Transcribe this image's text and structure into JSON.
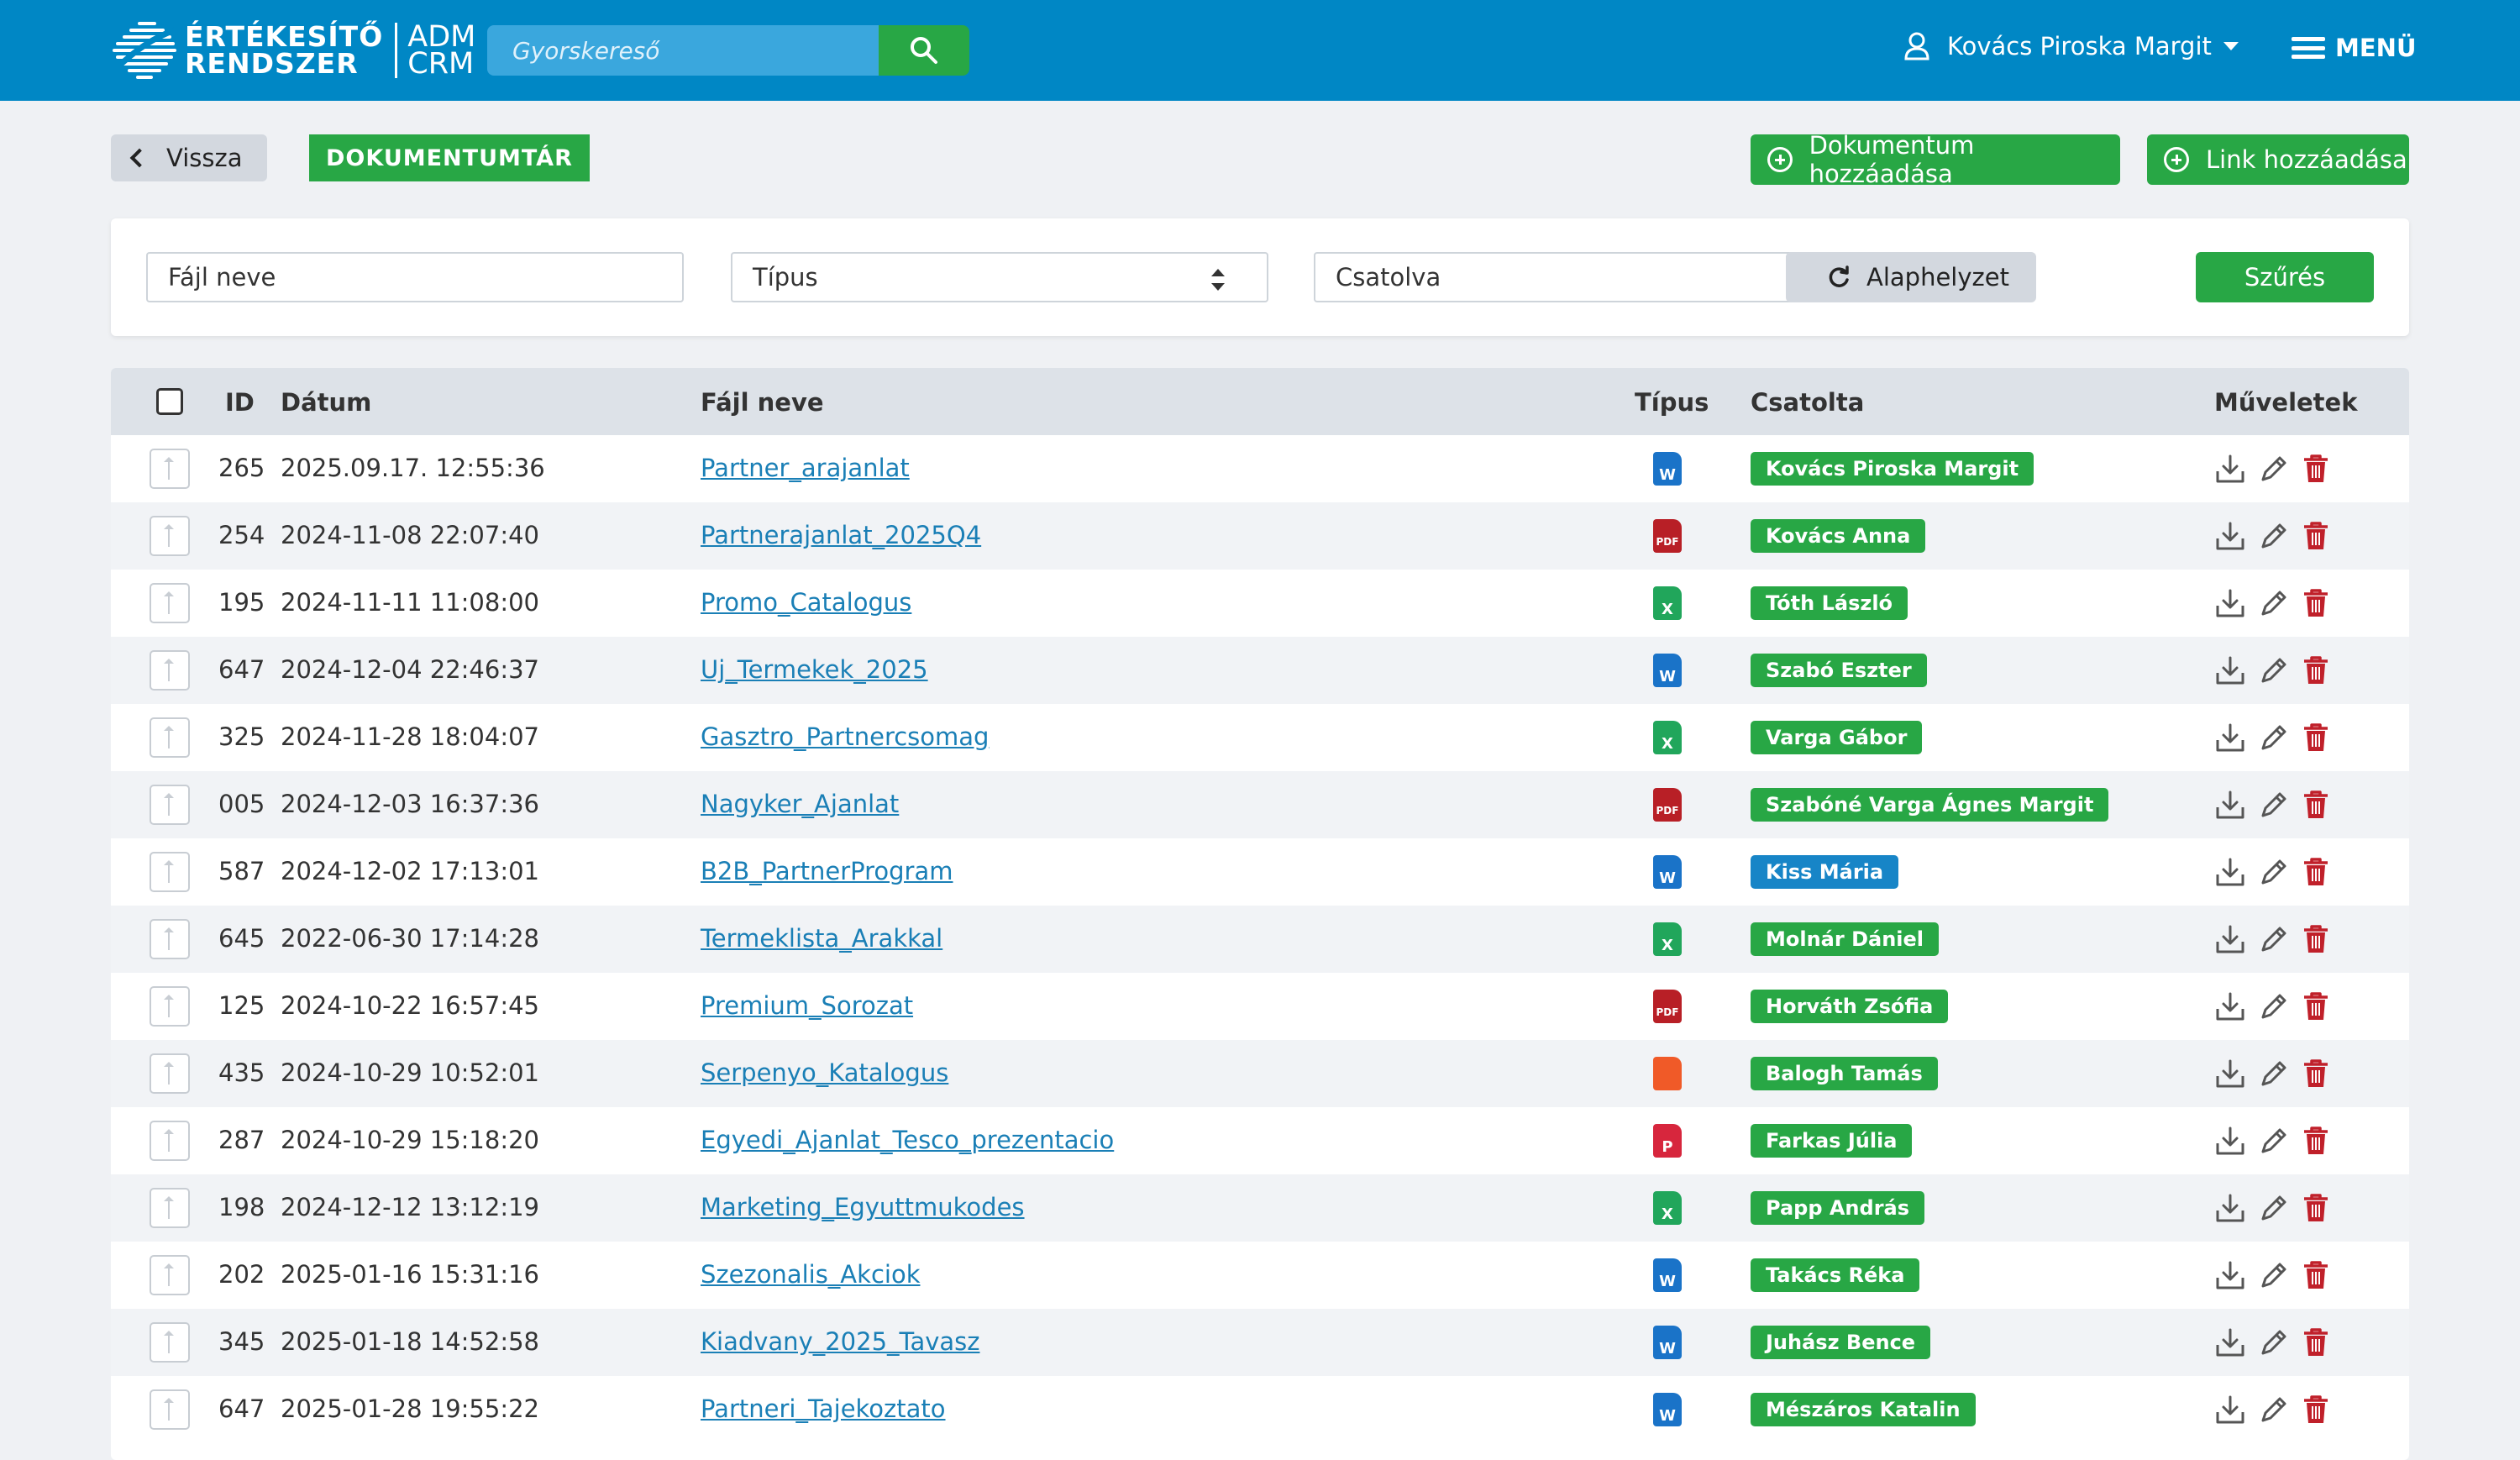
{
  "header": {
    "logo_line1": "ÉRTÉKESÍTŐ",
    "logo_line2": "RENDSZER",
    "logo_adm": "ADM",
    "logo_crm": "CRM",
    "search_placeholder": "Gyorskereső",
    "user_name": "Kovács Piroska Margit",
    "menu_label": "MENÜ"
  },
  "toolbar": {
    "back_label": "Vissza",
    "section_title": "DOKUMENTUMTÁR",
    "add_document_label": "Dokumentum hozzáadása",
    "add_link_label": "Link hozzáadása"
  },
  "filters": {
    "filename_placeholder": "Fájl neve",
    "type_select": "Típus",
    "attached_select": "Csatolva",
    "reset_label": "Alaphelyzet",
    "filter_label": "Szűrés"
  },
  "table": {
    "columns": {
      "id": "ID",
      "date": "Dátum",
      "filename": "Fájl neve",
      "type": "Típus",
      "attached_by": "Csatolta",
      "actions": "Műveletek"
    },
    "rows": [
      {
        "id": "265",
        "date": "2025.09.17. 12:55:36",
        "filename": "Partner_arajanlat",
        "type": "word",
        "attached_by": "Kovács Piroska Margit",
        "badge_color": "#28a745"
      },
      {
        "id": "254",
        "date": "2024-11-08 22:07:40",
        "filename": "Partnerajanlat_2025Q4",
        "type": "pdf",
        "attached_by": "Kovács Anna",
        "badge_color": "#28a745"
      },
      {
        "id": "195",
        "date": "2024-11-11 11:08:00",
        "filename": "Promo_Catalogus",
        "type": "excel",
        "attached_by": "Tóth László",
        "badge_color": "#28a745"
      },
      {
        "id": "647",
        "date": "2024-12-04 22:46:37",
        "filename": "Uj_Termekek_2025",
        "type": "word",
        "attached_by": "Szabó Eszter",
        "badge_color": "#28a745"
      },
      {
        "id": "325",
        "date": "2024-11-28 18:04:07",
        "filename": "Gasztro_Partnercsomag",
        "type": "excel",
        "attached_by": "Varga Gábor",
        "badge_color": "#28a745"
      },
      {
        "id": "005",
        "date": "2024-12-03 16:37:36",
        "filename": "Nagyker_Ajanlat",
        "type": "pdf",
        "attached_by": "Szabóné Varga Ágnes Margit",
        "badge_color": "#28a745"
      },
      {
        "id": "587",
        "date": "2024-12-02 17:13:01",
        "filename": "B2B_PartnerProgram",
        "type": "word",
        "attached_by": "Kiss Mária",
        "badge_color": "#1785c7"
      },
      {
        "id": "645",
        "date": "2022-06-30 17:14:28",
        "filename": "Termeklista_Arakkal",
        "type": "excel",
        "attached_by": "Molnár Dániel",
        "badge_color": "#28a745"
      },
      {
        "id": "125",
        "date": "2024-10-22 16:57:45",
        "filename": "Premium_Sorozat",
        "type": "pdf",
        "attached_by": "Horváth Zsófia",
        "badge_color": "#28a745"
      },
      {
        "id": "435",
        "date": "2024-10-29 10:52:01",
        "filename": "Serpenyo_Katalogus",
        "type": "image",
        "attached_by": "Balogh Tamás",
        "badge_color": "#28a745"
      },
      {
        "id": "287",
        "date": "2024-10-29 15:18:20",
        "filename": "Egyedi_Ajanlat_Tesco_prezentacio",
        "type": "powerpoint",
        "attached_by": "Farkas Júlia",
        "badge_color": "#28a745"
      },
      {
        "id": "198",
        "date": "2024-12-12 13:12:19",
        "filename": "Marketing_Egyuttmukodes",
        "type": "excel",
        "attached_by": "Papp András",
        "badge_color": "#28a745"
      },
      {
        "id": "202",
        "date": "2025-01-16 15:31:16",
        "filename": "Szezonalis_Akciok",
        "type": "word",
        "attached_by": "Takács Réka",
        "badge_color": "#28a745"
      },
      {
        "id": "345",
        "date": "2025-01-18 14:52:58",
        "filename": "Kiadvany_2025_Tavasz",
        "type": "word",
        "attached_by": "Juhász Bence",
        "badge_color": "#28a745"
      },
      {
        "id": "647",
        "date": "2025-01-28 19:55:22",
        "filename": "Partneri_Tajekoztato",
        "type": "word",
        "attached_by": "Mészáros Katalin",
        "badge_color": "#28a745"
      }
    ],
    "type_icons": {
      "word": "W",
      "excel": "X",
      "pdf": "PDF",
      "image": "",
      "powerpoint": "P"
    },
    "action_icons": [
      "download-icon",
      "edit-icon",
      "delete-icon"
    ]
  },
  "colors": {
    "header_bg": "#0087c5",
    "accent_green": "#28a745",
    "link_blue": "#1a7fb6",
    "delete_red": "#c0202a"
  }
}
